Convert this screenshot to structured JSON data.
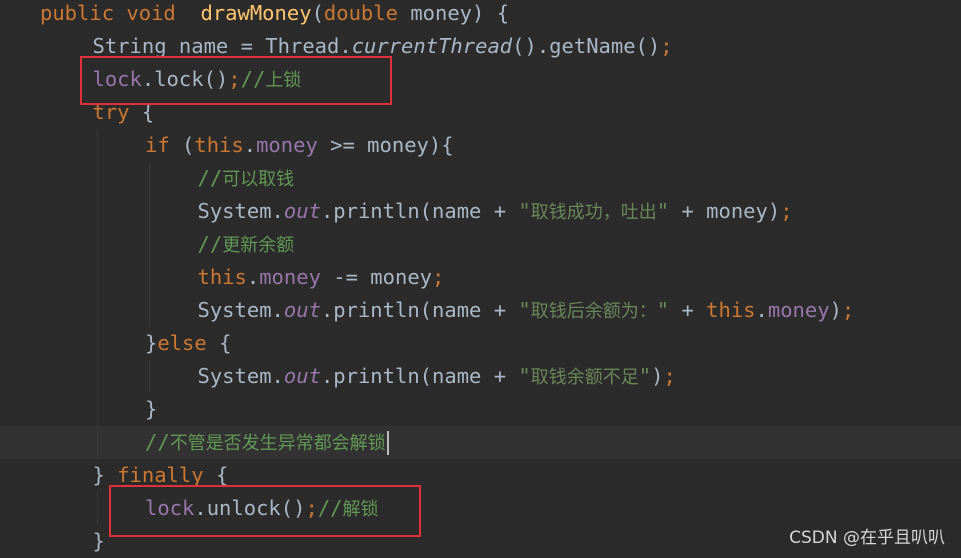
{
  "editor": {
    "lines": [
      {
        "indent": 0,
        "parts": [
          {
            "t": "public ",
            "c": "kw"
          },
          {
            "t": "void  ",
            "c": "kw"
          },
          {
            "t": "drawMoney",
            "c": "fn"
          },
          {
            "t": "(",
            "c": "plain"
          },
          {
            "t": "double ",
            "c": "kw"
          },
          {
            "t": "money) {",
            "c": "plain"
          }
        ]
      },
      {
        "indent": 1,
        "parts": [
          {
            "t": "String name = Thread.",
            "c": "plain"
          },
          {
            "t": "currentThread",
            "c": "italic"
          },
          {
            "t": "().getName()",
            "c": "plain"
          },
          {
            "t": ";",
            "c": "kw"
          }
        ]
      },
      {
        "indent": 1,
        "parts": [
          {
            "t": "lock",
            "c": "field"
          },
          {
            "t": ".lock()",
            "c": "plain"
          },
          {
            "t": ";",
            "c": "kw"
          },
          {
            "t": "//上锁",
            "c": "cmt"
          }
        ]
      },
      {
        "indent": 1,
        "parts": [
          {
            "t": "try ",
            "c": "kw"
          },
          {
            "t": "{",
            "c": "plain"
          }
        ]
      },
      {
        "indent": 2,
        "parts": [
          {
            "t": "if ",
            "c": "kw"
          },
          {
            "t": "(",
            "c": "plain"
          },
          {
            "t": "this",
            "c": "kw"
          },
          {
            "t": ".",
            "c": "plain"
          },
          {
            "t": "money",
            "c": "field"
          },
          {
            "t": " >= money){",
            "c": "plain"
          }
        ]
      },
      {
        "indent": 3,
        "parts": [
          {
            "t": "//可以取钱",
            "c": "cmt"
          }
        ]
      },
      {
        "indent": 3,
        "parts": [
          {
            "t": "System.",
            "c": "plain"
          },
          {
            "t": "out",
            "c": "static"
          },
          {
            "t": ".println(name + ",
            "c": "plain"
          },
          {
            "t": "\"取钱成功，吐出\"",
            "c": "str"
          },
          {
            "t": " + money)",
            "c": "plain"
          },
          {
            "t": ";",
            "c": "kw"
          }
        ]
      },
      {
        "indent": 3,
        "parts": [
          {
            "t": "//更新余额",
            "c": "cmt"
          }
        ]
      },
      {
        "indent": 3,
        "parts": [
          {
            "t": "this",
            "c": "kw"
          },
          {
            "t": ".",
            "c": "plain"
          },
          {
            "t": "money",
            "c": "field"
          },
          {
            "t": " -= money",
            "c": "plain"
          },
          {
            "t": ";",
            "c": "kw"
          }
        ]
      },
      {
        "indent": 3,
        "parts": [
          {
            "t": "System.",
            "c": "plain"
          },
          {
            "t": "out",
            "c": "static"
          },
          {
            "t": ".println(name + ",
            "c": "plain"
          },
          {
            "t": "\"取钱后余额为：\"",
            "c": "str"
          },
          {
            "t": " + ",
            "c": "plain"
          },
          {
            "t": "this",
            "c": "kw"
          },
          {
            "t": ".",
            "c": "plain"
          },
          {
            "t": "money",
            "c": "field"
          },
          {
            "t": ")",
            "c": "plain"
          },
          {
            "t": ";",
            "c": "kw"
          }
        ]
      },
      {
        "indent": 2,
        "parts": [
          {
            "t": "}",
            "c": "plain"
          },
          {
            "t": "else ",
            "c": "kw"
          },
          {
            "t": "{",
            "c": "plain"
          }
        ]
      },
      {
        "indent": 3,
        "parts": [
          {
            "t": "System.",
            "c": "plain"
          },
          {
            "t": "out",
            "c": "static"
          },
          {
            "t": ".println(name + ",
            "c": "plain"
          },
          {
            "t": "\"取钱余额不足\"",
            "c": "str"
          },
          {
            "t": ")",
            "c": "plain"
          },
          {
            "t": ";",
            "c": "kw"
          }
        ]
      },
      {
        "indent": 2,
        "parts": [
          {
            "t": "}",
            "c": "plain"
          }
        ]
      },
      {
        "indent": 2,
        "current": true,
        "caret": true,
        "parts": [
          {
            "t": "//不管是否发生异常都会解锁",
            "c": "cmt"
          }
        ]
      },
      {
        "indent": 1,
        "parts": [
          {
            "t": "} ",
            "c": "plain"
          },
          {
            "t": "finally ",
            "c": "kw"
          },
          {
            "t": "{",
            "c": "plain"
          }
        ]
      },
      {
        "indent": 2,
        "parts": [
          {
            "t": "lock",
            "c": "field"
          },
          {
            "t": ".unlock()",
            "c": "plain"
          },
          {
            "t": ";",
            "c": "kw"
          },
          {
            "t": "//解锁",
            "c": "cmt"
          }
        ]
      },
      {
        "indent": 1,
        "parts": [
          {
            "t": "}",
            "c": "plain"
          }
        ]
      }
    ]
  },
  "highlights": [
    {
      "name": "lock-highlight-box",
      "line": 2
    },
    {
      "name": "unlock-highlight-box",
      "line": 15
    }
  ],
  "watermark": "CSDN @在乎且叭叭",
  "colors": {
    "background": "#2b2b2b",
    "keyword": "#cc7832",
    "method": "#ffc66d",
    "field": "#9876aa",
    "string": "#6a8759",
    "comment": "#629755",
    "text": "#a9b7c6",
    "highlight_box": "#e0313a"
  }
}
